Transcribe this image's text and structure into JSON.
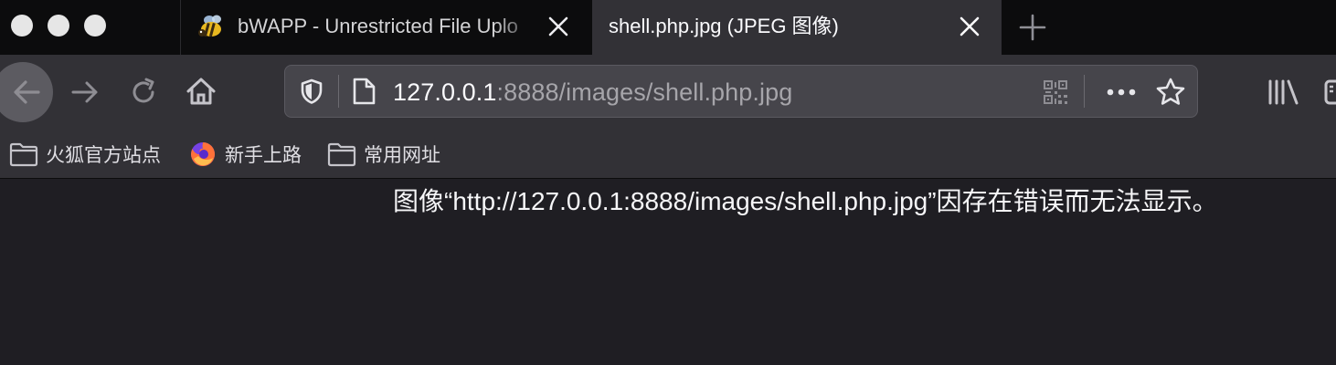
{
  "window": {
    "controls": [
      "close",
      "minimize",
      "maximize"
    ]
  },
  "tabs": [
    {
      "title": "bWAPP - Unrestricted File Uplo",
      "favicon": "bee-icon",
      "active": false
    },
    {
      "title": "shell.php.jpg (JPEG 图像)",
      "favicon": "",
      "active": true
    }
  ],
  "toolbar": {
    "back_icon": "back-arrow-icon",
    "forward_icon": "forward-arrow-icon",
    "reload_icon": "reload-icon",
    "home_icon": "home-icon",
    "library_icon": "library-icon",
    "sidebar_icon": "sidebar-icon"
  },
  "urlbar": {
    "host": "127.0.0.1",
    "rest": ":8888/images/shell.php.jpg",
    "icons": [
      "shield-icon",
      "page-icon",
      "qr-code-icon",
      "more-icon",
      "star-icon"
    ]
  },
  "bookmarks": [
    {
      "label": "火狐官方站点",
      "icon": "folder-icon"
    },
    {
      "label": "新手上路",
      "icon": "firefox-icon"
    },
    {
      "label": "常用网址",
      "icon": "folder-icon"
    }
  ],
  "content": {
    "message": "图像“http://127.0.0.1:8888/images/shell.php.jpg”因存在错误而无法显示。"
  },
  "colors": {
    "tabstrip_bg": "#0c0c0d",
    "toolbar_bg": "#323136",
    "urlbar_bg": "#46454b",
    "content_bg": "#1f1e23",
    "text_primary": "#fbfbfe",
    "text_dim": "#a6a5aa"
  }
}
